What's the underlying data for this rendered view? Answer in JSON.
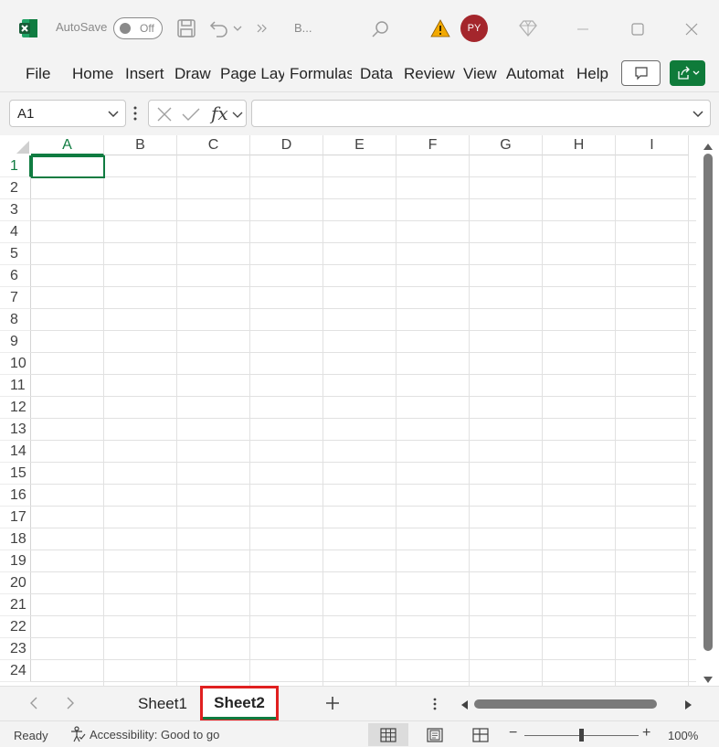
{
  "titlebar": {
    "app_icon": "excel-logo",
    "autosave_label": "AutoSave",
    "autosave_state": "Off",
    "book_name": "B...",
    "avatar_initials": "PY",
    "icons": [
      "save-icon",
      "undo-icon",
      "chevron-down-icon",
      "more-commands-icon",
      "search-icon",
      "warning-icon",
      "diamond-icon",
      "minimize-icon",
      "maximize-icon",
      "close-icon"
    ]
  },
  "ribbon": {
    "tabs": [
      "File",
      "Home",
      "Insert",
      "Draw",
      "Page Lay",
      "Formulas",
      "Data",
      "Review",
      "View",
      "Automat",
      "Help"
    ]
  },
  "formula_bar": {
    "name_box": "A1",
    "fx_label": "fx",
    "formula_value": ""
  },
  "grid": {
    "columns": [
      "A",
      "B",
      "C",
      "D",
      "E",
      "F",
      "G",
      "H",
      "I"
    ],
    "rows": [
      "1",
      "2",
      "3",
      "4",
      "5",
      "6",
      "7",
      "8",
      "9",
      "10",
      "11",
      "12",
      "13",
      "14",
      "15",
      "16",
      "17",
      "18",
      "19",
      "20",
      "21",
      "22",
      "23",
      "24"
    ],
    "active_cell": "A1"
  },
  "sheets": {
    "tabs": [
      "Sheet1",
      "Sheet2"
    ],
    "active": "Sheet2",
    "add_label": "+"
  },
  "statusbar": {
    "ready": "Ready",
    "accessibility": "Accessibility: Good to go",
    "zoom_minus": "−",
    "zoom_plus": "+",
    "zoom": "100%"
  },
  "colors": {
    "accent": "#107c41",
    "avatar": "#a4262c",
    "highlight": "#e02020",
    "warning": "#f2a900"
  }
}
